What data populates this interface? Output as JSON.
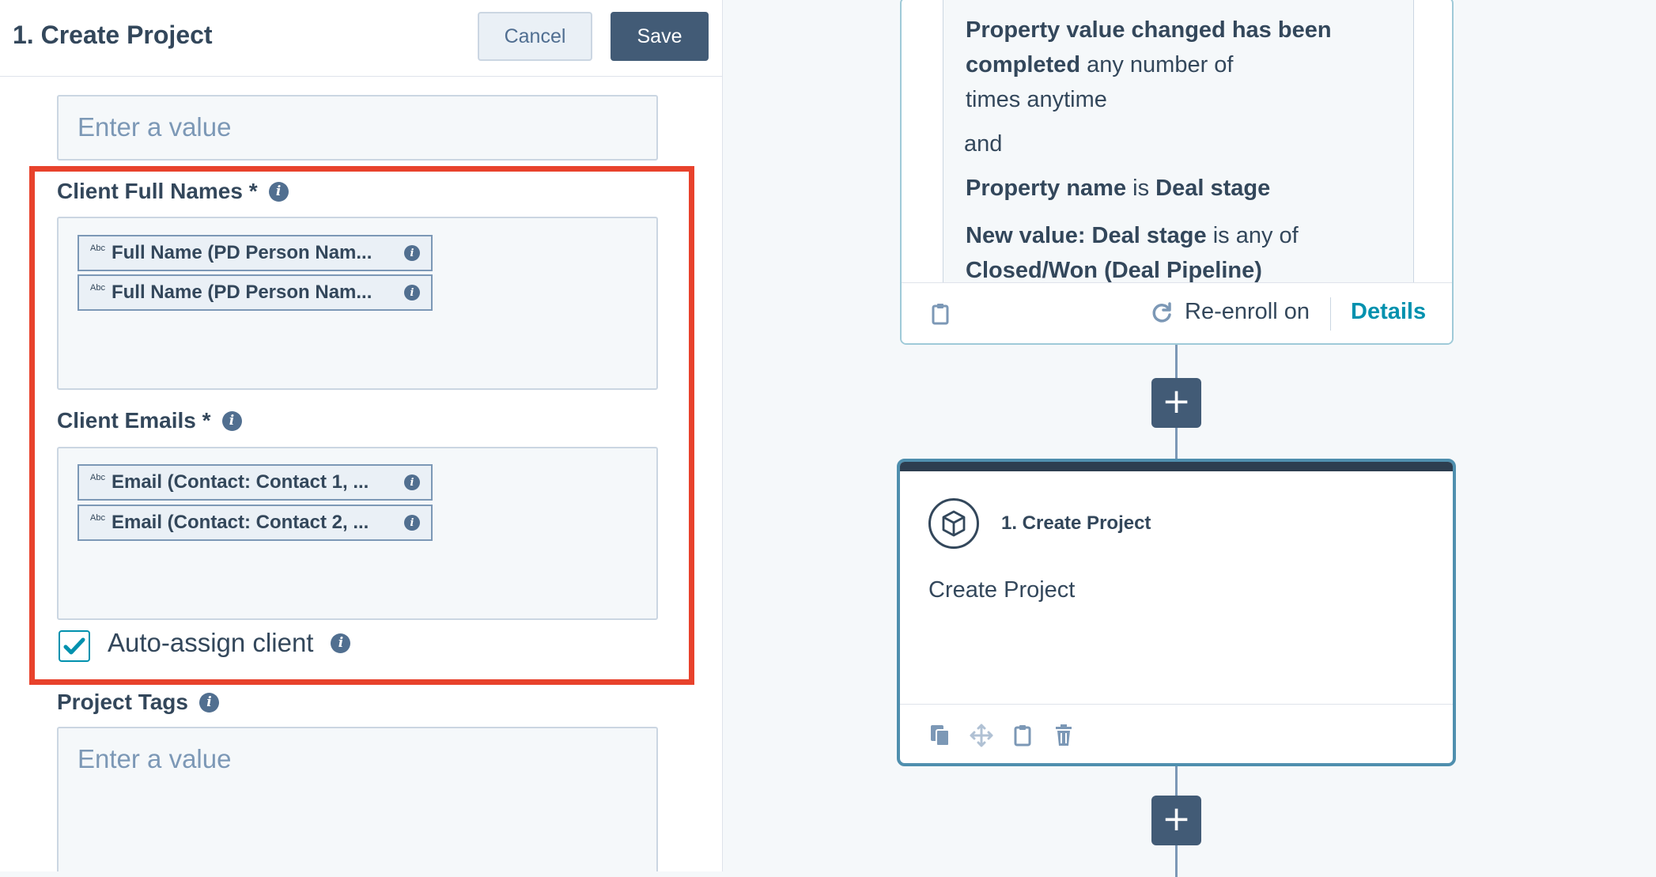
{
  "panel": {
    "title": "1. Create Project",
    "cancel_label": "Cancel",
    "save_label": "Save",
    "top_input_placeholder": "Enter a value",
    "client_full_names": {
      "label": "Client Full Names *",
      "tokens": [
        {
          "badge": "Abc",
          "text": "Full Name (PD Person Nam..."
        },
        {
          "badge": "Abc",
          "text": "Full Name (PD Person Nam..."
        }
      ]
    },
    "client_emails": {
      "label": "Client Emails *",
      "tokens": [
        {
          "badge": "Abc",
          "text": "Email (Contact: Contact 1, ..."
        },
        {
          "badge": "Abc",
          "text": "Email (Contact: Contact 2, ..."
        }
      ]
    },
    "auto_assign": {
      "label": "Auto-assign client",
      "checked": true
    },
    "project_tags": {
      "label": "Project Tags",
      "placeholder": "Enter a value"
    }
  },
  "trigger_card": {
    "line1_bold": "Property value changed has been",
    "line2_bold": "completed",
    "line2_rest": " any number of",
    "line3": "times anytime",
    "and_label": "and",
    "line5_bold_a": "Property name",
    "line5_mid": " is ",
    "line5_bold_b": "Deal stage",
    "line6_bold": "New value: Deal stage",
    "line6_rest": " is any of",
    "line7_bold": "Closed/Won (Deal Pipeline)",
    "reenroll_label": "Re-enroll on",
    "details_label": "Details"
  },
  "action_card": {
    "title": "1. Create Project",
    "description": "Create Project"
  },
  "add_action_glyph": "+",
  "colors": {
    "highlight": "#e8422c",
    "accent_teal": "#0091ae",
    "button_dark": "#425b76",
    "text_primary": "#33475b"
  },
  "icons": [
    "info-icon",
    "check-icon",
    "clipboard-icon",
    "refresh-icon",
    "cube-icon",
    "copy-icon",
    "move-icon",
    "trash-icon",
    "plus-icon"
  ]
}
